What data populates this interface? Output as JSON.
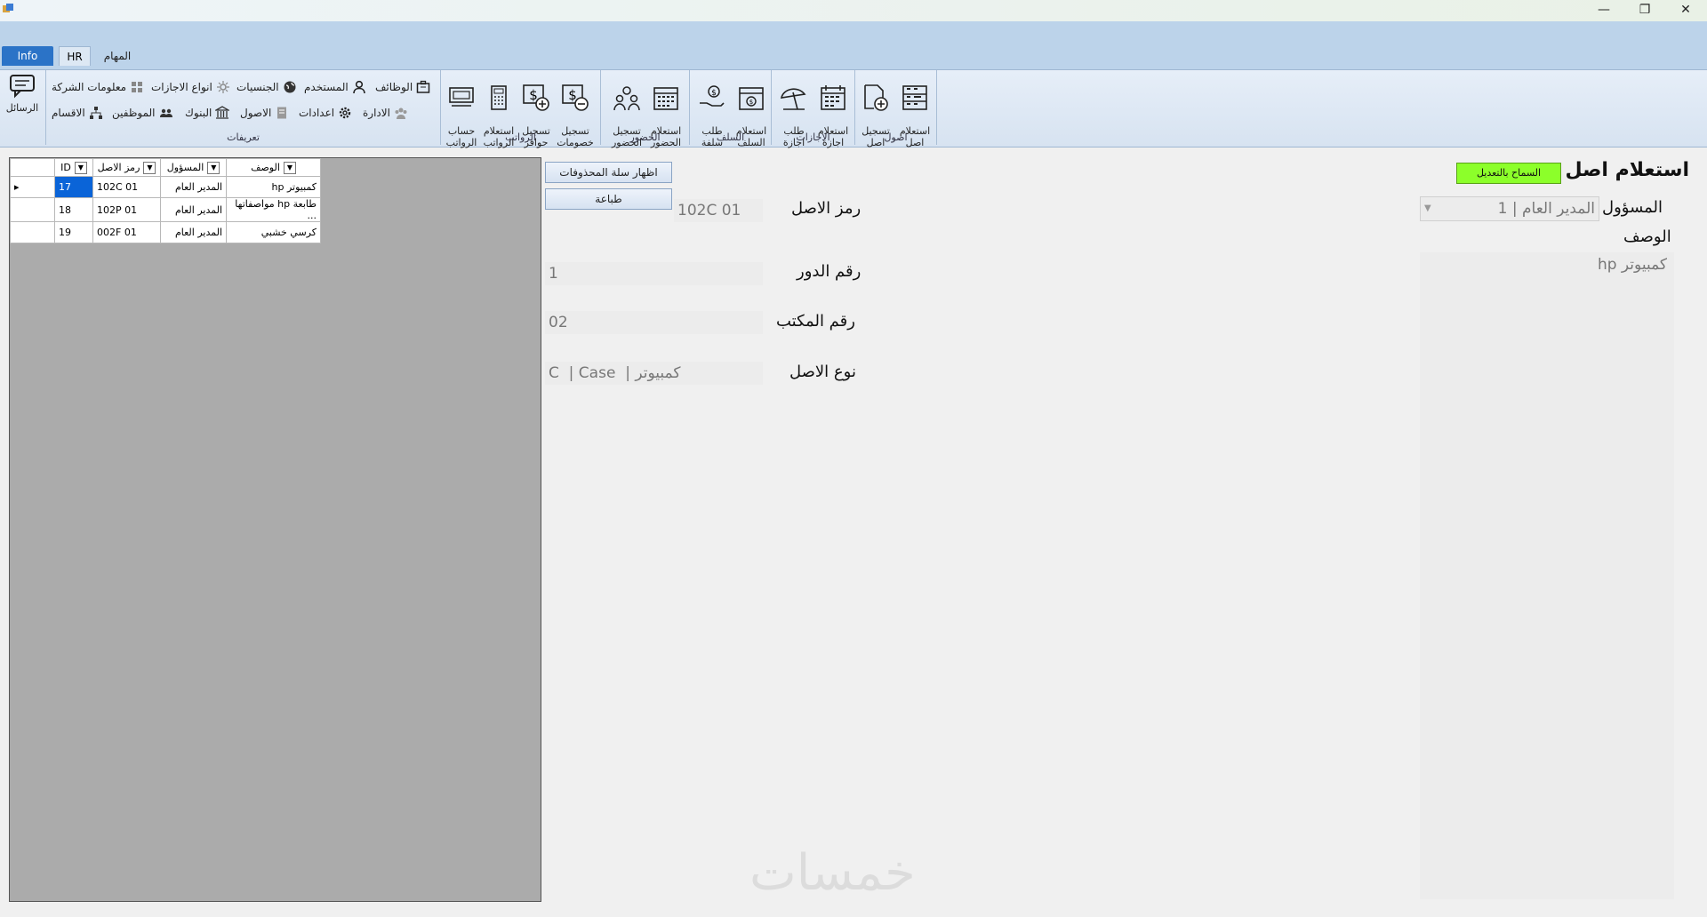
{
  "window": {
    "minimize": "—",
    "maximize": "❐",
    "close": "✕"
  },
  "tabs": {
    "info": "Info",
    "hr": "HR",
    "tasks": "المهام"
  },
  "ribbon": {
    "messages": "الرسائل",
    "definitions": {
      "label": "تعريفات",
      "company_info": "معلومات الشركة",
      "leave_types": "انواع الاجازات",
      "nationalities": "الجنسيات",
      "user": "المستخدم",
      "jobs": "الوظائف",
      "departments": "الاقسام",
      "employees": "الموظفين",
      "banks": "البنوك",
      "assets": "الاصول",
      "settings": "اعدادات",
      "administration": "الادارة"
    },
    "salaries": {
      "label": "الرواتب",
      "calc": "حساب\nالرواتب",
      "inquiry": "استعلام\nالرواتب",
      "incentives": "تسجيل\nحوافز",
      "deductions": "تسجيل\nخصومات"
    },
    "attendance": {
      "label": "الحضور",
      "register": "تسجيل\nالحضور",
      "inquiry": "استعلام\nالحضور"
    },
    "advances": {
      "label": "السلف",
      "request": "طلب\nسلفة",
      "inquiry": "استعلام\nالسلف"
    },
    "leaves": {
      "label": "الاجازات",
      "request": "طلب\nاجازة",
      "inquiry": "استعلام\nاجازة"
    },
    "assets": {
      "label": "اصول",
      "register": "تسجيل\nاصل",
      "inquiry": "استعلام\nاصل"
    }
  },
  "grid": {
    "columns": [
      "ID",
      "رمز الاصل",
      "المسؤول",
      "الوصف"
    ],
    "rows": [
      {
        "id": "17",
        "code": "102C 01",
        "owner": "المدير العام",
        "desc": "كمبيوتر hp"
      },
      {
        "id": "18",
        "code": "102P 01",
        "owner": "المدير العام",
        "desc": "طابعة hp مواصفاتها ..."
      },
      {
        "id": "19",
        "code": "002F 01",
        "owner": "المدير العام",
        "desc": "كرسي خشبي"
      }
    ]
  },
  "buttons": {
    "show_deleted": "اظهار سلة المحذوفات",
    "print": "طباعة",
    "allow_edit": "السماح بالتعديل"
  },
  "form": {
    "title": "استعلام اصل",
    "asset_code_label": "رمز الاصل",
    "asset_code_value": "102C 01",
    "floor_label": "رقم الدور",
    "floor_value": "1",
    "office_label": "رقم المكتب",
    "office_value": "02",
    "asset_type_label": "نوع الاصل",
    "asset_type_value": "C  | Case  | كمبيوتر",
    "owner_label": "المسؤول",
    "owner_value": "المدير العام | 1",
    "desc_label": "الوصف",
    "desc_value": "كمبيوتر hp"
  },
  "watermark": "خمسات"
}
